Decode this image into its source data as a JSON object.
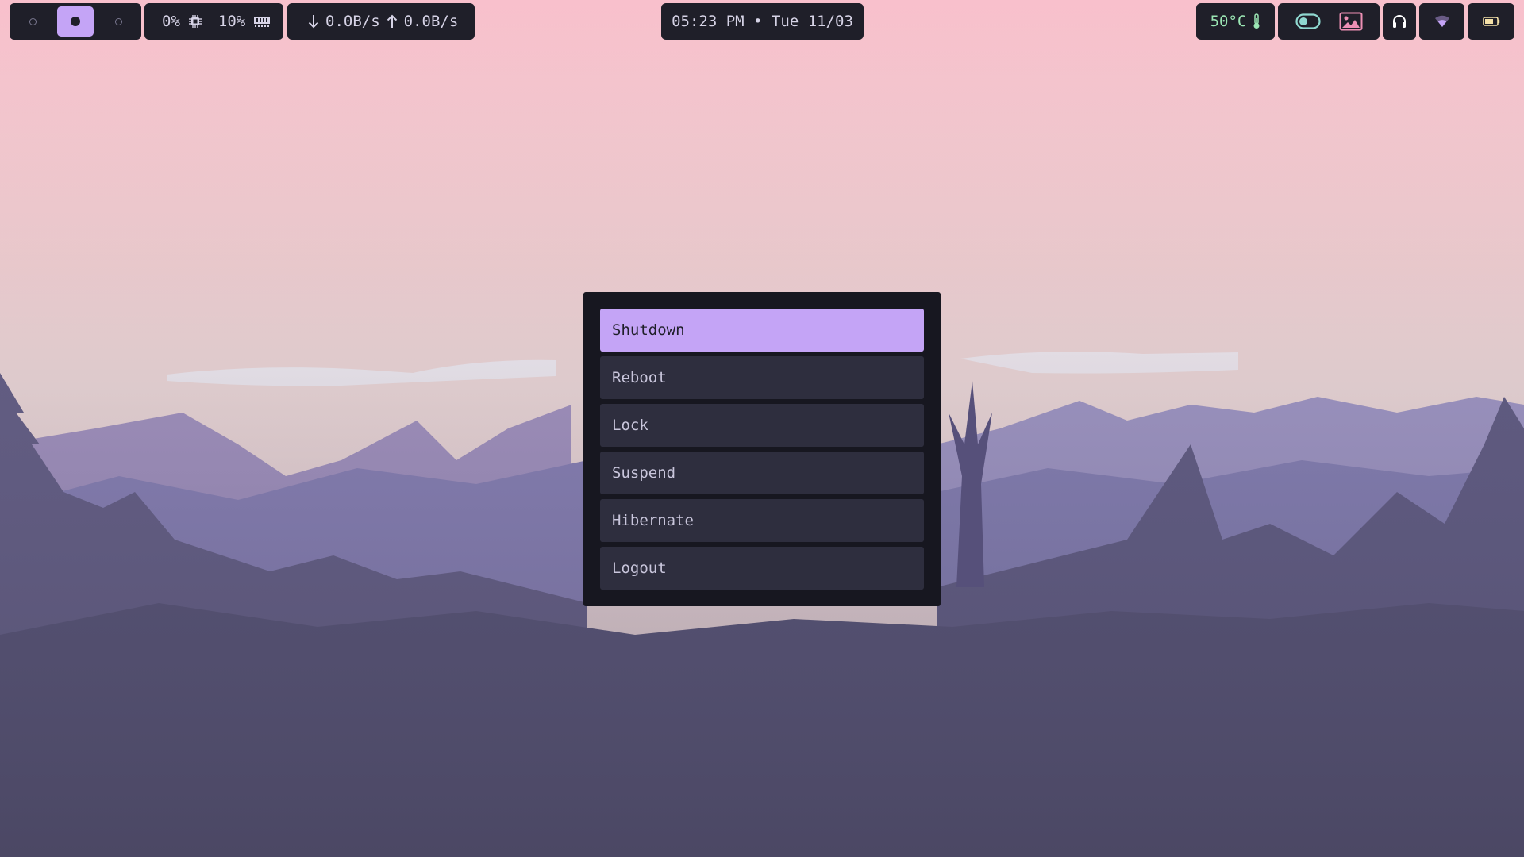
{
  "workspaces": {
    "items": [
      {
        "state": "empty"
      },
      {
        "state": "active"
      },
      {
        "state": "empty"
      }
    ]
  },
  "system": {
    "cpu": "0%",
    "cpu_icon": "cpu-chip-icon",
    "memory": "10%",
    "memory_icon": "ram-icon"
  },
  "network": {
    "down_icon": "arrow-down-icon",
    "down": "0.0B/s",
    "up_icon": "arrow-up-icon",
    "up": "0.0B/s"
  },
  "clock": {
    "text": "05:23 PM • Tue 11/03"
  },
  "status": {
    "temperature": "50°C",
    "temperature_icon": "thermometer-icon",
    "toggle_icon": "toggle-icon",
    "wallpaper_icon": "image-icon",
    "audio_icon": "headphones-icon",
    "wifi_icon": "wifi-icon",
    "battery_icon": "battery-icon"
  },
  "power_menu": {
    "items": [
      {
        "label": "Shutdown",
        "selected": true
      },
      {
        "label": "Reboot"
      },
      {
        "label": "Lock"
      },
      {
        "label": "Suspend"
      },
      {
        "label": "Hibernate"
      },
      {
        "label": "Logout"
      }
    ]
  },
  "colors": {
    "accent": "#c4a4f6",
    "bar_bg": "#1f1f29",
    "menu_bg": "#171720",
    "menu_item_bg": "#2e2e3e",
    "temp_green": "#9be6b4",
    "pink_icon": "#ec8fb4"
  }
}
